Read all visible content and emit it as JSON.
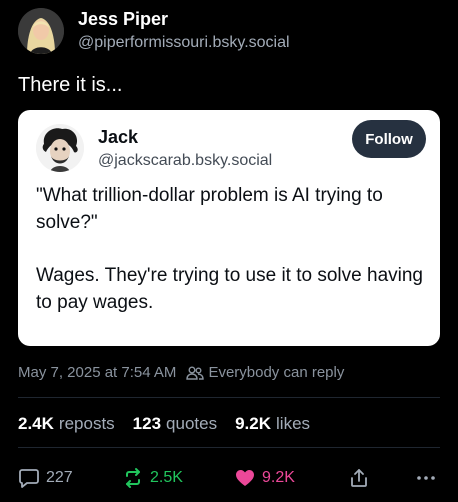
{
  "author": {
    "display_name": "Jess Piper",
    "handle": "@piperformissouri.bsky.social"
  },
  "post": {
    "text": "There it is..."
  },
  "quoted_post": {
    "display_name": "Jack",
    "handle": "@jackscarab.bsky.social",
    "follow_label": "Follow",
    "paragraphs": [
      "\"What trillion-dollar problem is AI trying to solve?\"",
      "Wages. They're trying to use it to solve having to pay wages."
    ]
  },
  "meta": {
    "timestamp": "May 7, 2025 at 7:54 AM",
    "reply_setting": "Everybody can reply"
  },
  "stats": {
    "reposts_count": "2.4K",
    "reposts_label": "reposts",
    "quotes_count": "123",
    "quotes_label": "quotes",
    "likes_count": "9.2K",
    "likes_label": "likes"
  },
  "actions": {
    "reply_count": "227",
    "repost_count": "2.5K",
    "like_count": "9.2K"
  },
  "colors": {
    "background": "#000000",
    "muted_text": "#a3acb8",
    "repost_green": "#21c55d",
    "like_pink": "#ec4899",
    "follow_button": "#263140"
  },
  "icons": {
    "reply": "speech-bubble-icon",
    "repost": "repost-arrows-icon",
    "like": "heart-icon",
    "share": "share-icon",
    "more": "ellipsis-icon",
    "reply_setting": "people-icon"
  }
}
